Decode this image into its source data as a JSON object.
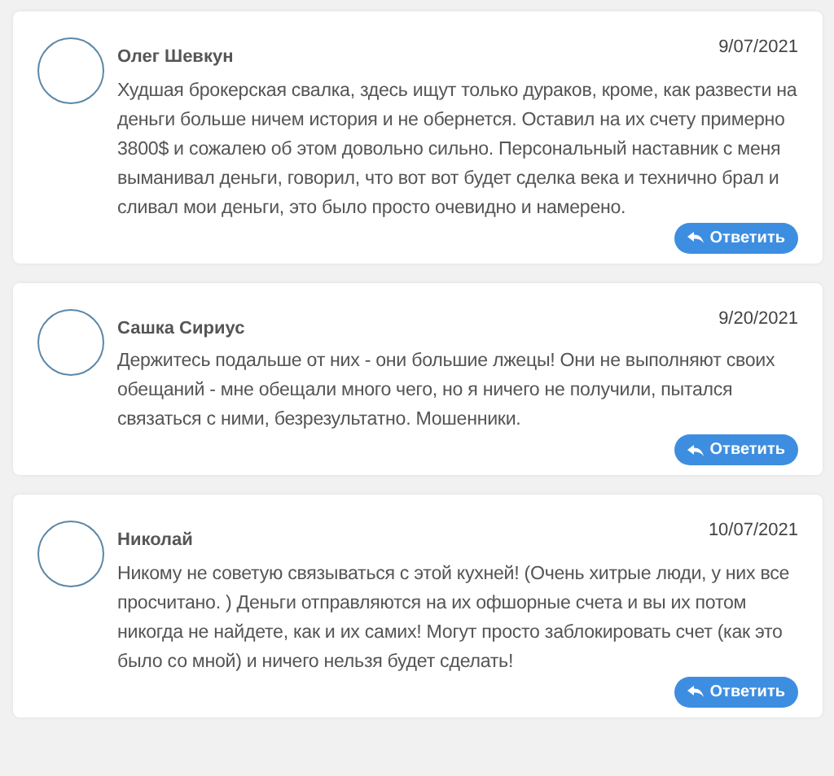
{
  "reviews": [
    {
      "author": "Олег Шевкун",
      "date": "9/07/2021",
      "text": "Худшая брокерская свалка, здесь ищут только дураков, кроме, как развести на деньги больше ничем история и не обернется. Оставил на их счету примерно 3800$ и сожалею об этом довольно сильно. Персональный наставник с меня выманивал деньги, говорил, что вот вот будет сделка века и технично брал и сливал мои деньги, это было просто очевидно и намерено.",
      "reply": "Ответить"
    },
    {
      "author": "Сашка Сириус",
      "date": "9/20/2021",
      "text": "Держитесь подальше от них - они большие лжецы! Они не выполняют своих обещаний - мне обещали много чего, но я ничего не получили, пытался связаться с ними, безрезультатно. Мошенники.",
      "reply": "Ответить"
    },
    {
      "author": "Николай",
      "date": "10/07/2021",
      "text": "Никому не советую связываться с этой кухней! (Очень хитрые люди, у них все просчитано. ) Деньги отправляются на их офшорные счета и вы их потом никогда не найдете, как и их самих! Могут просто заблокировать счет (как это было со мной) и ничего нельзя будет сделать!",
      "reply": "Ответить"
    }
  ]
}
